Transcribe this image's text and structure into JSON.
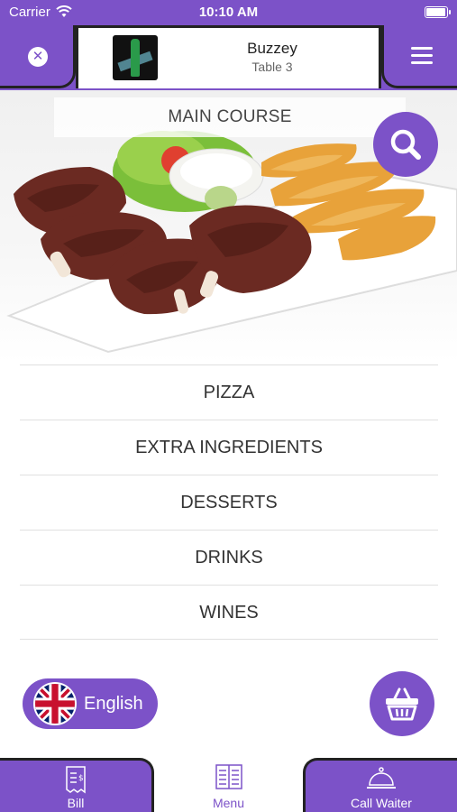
{
  "status_bar": {
    "carrier": "Carrier",
    "time": "10:10 AM",
    "battery_level": 1.0
  },
  "header": {
    "close_icon": "close-icon",
    "menu_icon": "hamburger-menu-icon",
    "venue_name": "Buzzey",
    "table_label": "Table 3"
  },
  "hero": {
    "category_title": "MAIN COURSE",
    "search_icon": "search-icon"
  },
  "categories": [
    "PIZZA",
    "EXTRA INGREDIENTS",
    "DESSERTS",
    "DRINKS",
    "WINES"
  ],
  "language": {
    "label": "English",
    "flag_icon": "uk-flag-icon"
  },
  "cart": {
    "icon": "basket-icon"
  },
  "tabs": [
    {
      "label": "Bill",
      "icon": "receipt-icon"
    },
    {
      "label": "Menu",
      "icon": "menu-book-icon"
    },
    {
      "label": "Call Waiter",
      "icon": "service-bell-icon"
    }
  ],
  "colors": {
    "accent": "#7c52c8",
    "text": "#333333",
    "divider": "#e0e0e0"
  }
}
